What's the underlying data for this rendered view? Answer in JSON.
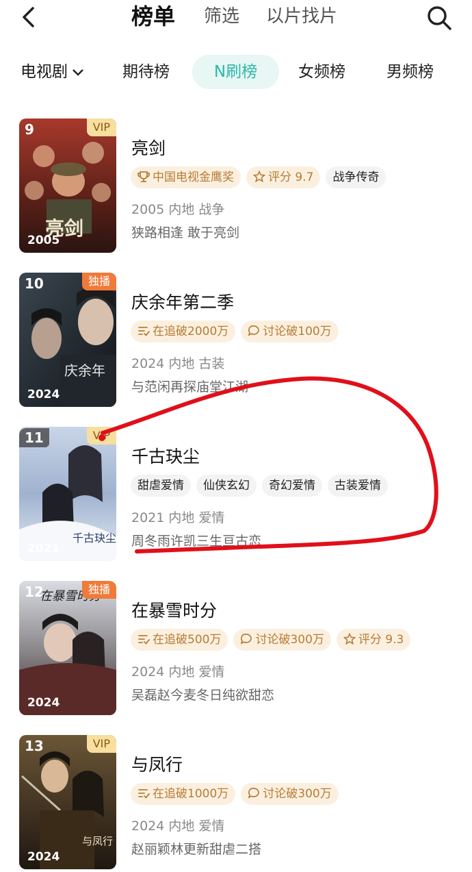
{
  "header": {
    "title": "榜单",
    "tabs": [
      "筛选",
      "以片找片"
    ]
  },
  "category": {
    "selected": "电视剧",
    "tabs": [
      "期待榜",
      "N刷榜",
      "女频榜",
      "男频榜"
    ],
    "active_tab": "N刷榜"
  },
  "items": [
    {
      "rank": "9",
      "badge": "VIP",
      "year": "2005",
      "title": "亮剑",
      "poster_text": "亮剑",
      "tags": [
        {
          "icon": "trophy-icon",
          "text": "中国电视金鹰奖",
          "style": "gold"
        },
        {
          "icon": "star-icon",
          "text": "评分 9.7",
          "style": "gold"
        },
        {
          "icon": "",
          "text": "战争传奇",
          "style": "plain"
        }
      ],
      "meta": "2005 内地 战争",
      "desc": "狭路相逢 敢于亮剑"
    },
    {
      "rank": "10",
      "badge": "独播",
      "year": "2024",
      "title": "庆余年第二季",
      "poster_text": "庆余年",
      "tags": [
        {
          "icon": "list-icon",
          "text": "在追破2000万",
          "style": "gold"
        },
        {
          "icon": "comment-icon",
          "text": "讨论破100万",
          "style": "gold"
        }
      ],
      "meta": "2024 内地 古装",
      "desc": "与范闲再探庙堂江湖"
    },
    {
      "rank": "11",
      "badge": "VIP",
      "year": "2021",
      "title": "千古玦尘",
      "poster_text": "千古玦尘",
      "tags": [
        {
          "icon": "",
          "text": "甜虐爱情",
          "style": "plain"
        },
        {
          "icon": "",
          "text": "仙侠玄幻",
          "style": "plain"
        },
        {
          "icon": "",
          "text": "奇幻爱情",
          "style": "plain"
        },
        {
          "icon": "",
          "text": "古装爱情",
          "style": "plain"
        }
      ],
      "meta": "2021 内地 爱情",
      "desc": "周冬雨许凯三生亘古恋"
    },
    {
      "rank": "12",
      "badge": "独播",
      "year": "2024",
      "title": "在暴雪时分",
      "poster_text": "在暴雪时分",
      "tags": [
        {
          "icon": "list-icon",
          "text": "在追破500万",
          "style": "gold"
        },
        {
          "icon": "comment-icon",
          "text": "讨论破300万",
          "style": "gold"
        },
        {
          "icon": "star-icon",
          "text": "评分 9.3",
          "style": "gold"
        }
      ],
      "meta": "2024 内地 爱情",
      "desc": "吴磊赵今麦冬日纯欲甜恋"
    },
    {
      "rank": "13",
      "badge": "VIP",
      "year": "2024",
      "title": "与凤行",
      "poster_text": "与凤行",
      "tags": [
        {
          "icon": "list-icon",
          "text": "在追破1000万",
          "style": "gold"
        },
        {
          "icon": "comment-icon",
          "text": "讨论破300万",
          "style": "gold"
        }
      ],
      "meta": "2024 内地 爱情",
      "desc": "赵丽颖林更新甜虐二搭"
    }
  ],
  "colors": {
    "accent": "#2ab8a5",
    "gold_tag": "#b87b33",
    "vip_badge": "#f7dfa0",
    "exclusive_badge": "#f07a3a",
    "annotation_red": "#e0101a"
  }
}
